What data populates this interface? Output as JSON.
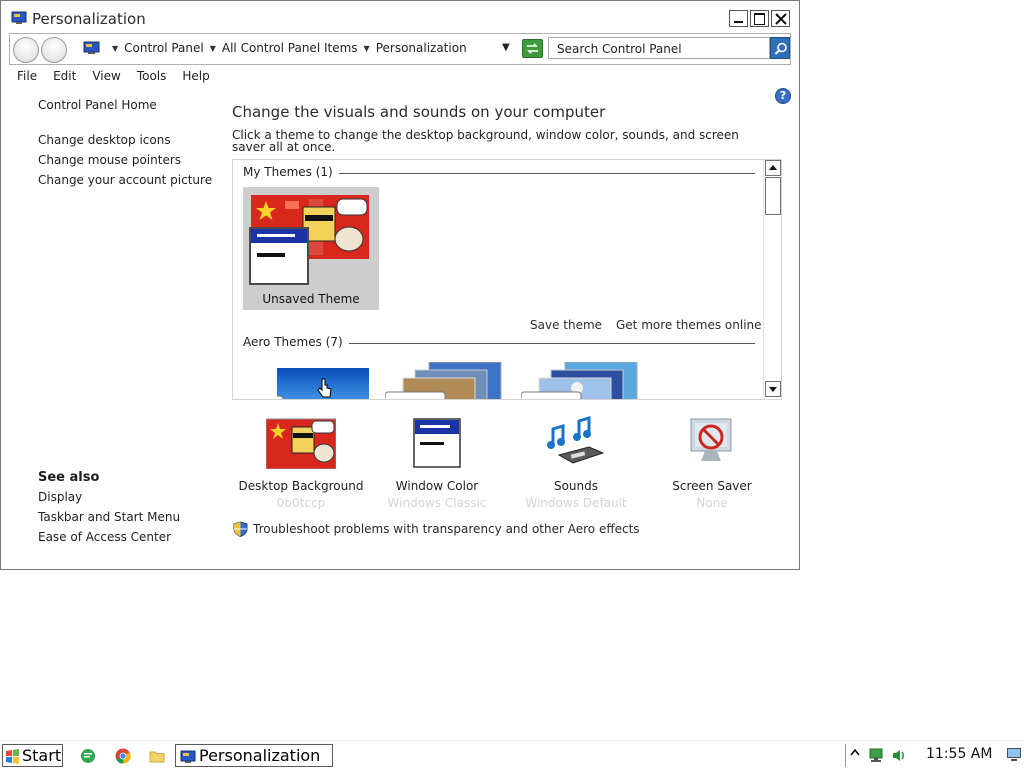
{
  "window": {
    "title": "Personalization",
    "icon": "control-panel-icon"
  },
  "address": {
    "crumbs": [
      "Control Panel",
      "All Control Panel Items",
      "Personalization"
    ],
    "search_placeholder": "Search Control Panel"
  },
  "menu": [
    "File",
    "Edit",
    "View",
    "Tools",
    "Help"
  ],
  "sidebar": {
    "home": "Control Panel Home",
    "links": [
      "Change desktop icons",
      "Change mouse pointers",
      "Change your account picture"
    ],
    "see_also_title": "See also",
    "see_also": [
      "Display",
      "Taskbar and Start Menu",
      "Ease of Access Center"
    ]
  },
  "main": {
    "title": "Change the visuals and sounds on your computer",
    "description": "Click a theme to change the desktop background, window color, sounds, and screen saver all at once.",
    "my_themes_header": "My Themes (1)",
    "unsaved_theme_label": "Unsaved Theme",
    "save_theme": "Save theme",
    "get_more_themes": "Get more themes online",
    "aero_themes_header": "Aero Themes (7)"
  },
  "options": [
    {
      "label": "Desktop Background",
      "sub": "0b0tccp",
      "icon": "desktop-background-icon"
    },
    {
      "label": "Window Color",
      "sub": "Windows Classic",
      "icon": "window-color-icon"
    },
    {
      "label": "Sounds",
      "sub": "Windows Default",
      "icon": "sounds-icon"
    },
    {
      "label": "Screen Saver",
      "sub": "None",
      "icon": "screen-saver-icon"
    }
  ],
  "troubleshoot": "Troubleshoot problems with transparency and other Aero effects",
  "taskbar": {
    "start_label": "Start",
    "task_label": "Personalization",
    "clock": "11:55 AM"
  },
  "colors": {
    "accent_blue": "#1c33a8",
    "flag_red": "#d8281e",
    "subtitle_gray": "#d3d3d3"
  }
}
